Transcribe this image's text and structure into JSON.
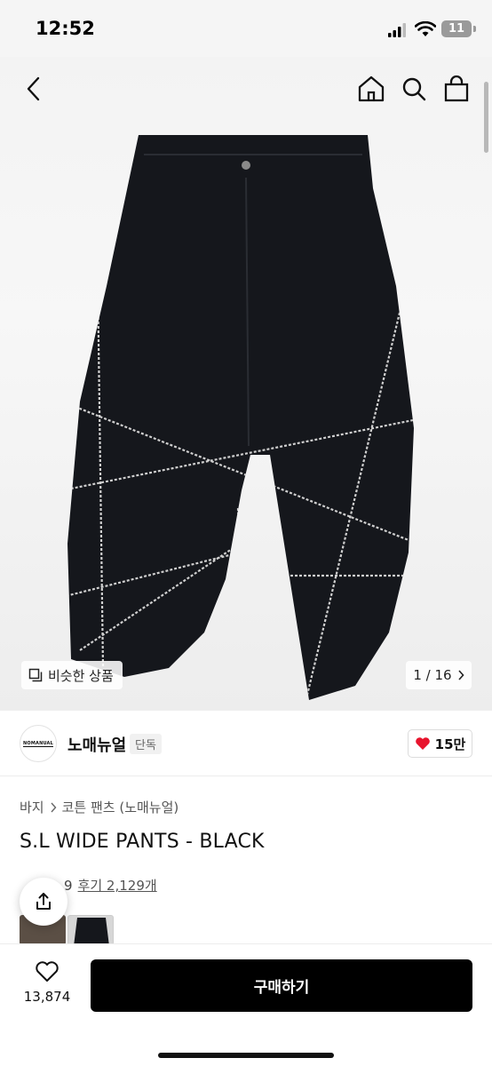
{
  "status_bar": {
    "time": "12:52",
    "battery": "11"
  },
  "nav": {
    "back_icon": "chevron-left-icon",
    "home_icon": "home-icon",
    "search_icon": "search-icon",
    "cart_icon": "shopping-bag-icon"
  },
  "hero": {
    "image_alt_icon": "product-image",
    "similar_label": "비슷한 상품",
    "page_counter": "1 / 16"
  },
  "brand": {
    "logo_text": "NOMANUAL",
    "name": "노매뉴얼",
    "badge": "단독",
    "likes": "15만"
  },
  "product": {
    "breadcrumb": [
      "바지",
      "코튼 팬츠 (노매뉴얼)"
    ],
    "title": "S.L WIDE PANTS - BLACK",
    "rating_fragment": "9",
    "reviews": "후기 2,129개"
  },
  "bottom_bar": {
    "wish_count": "13,874",
    "buy_label": "구매하기"
  },
  "colors": {
    "accent": "#000000",
    "heart": "#e8142d",
    "star": "#f5b400"
  }
}
